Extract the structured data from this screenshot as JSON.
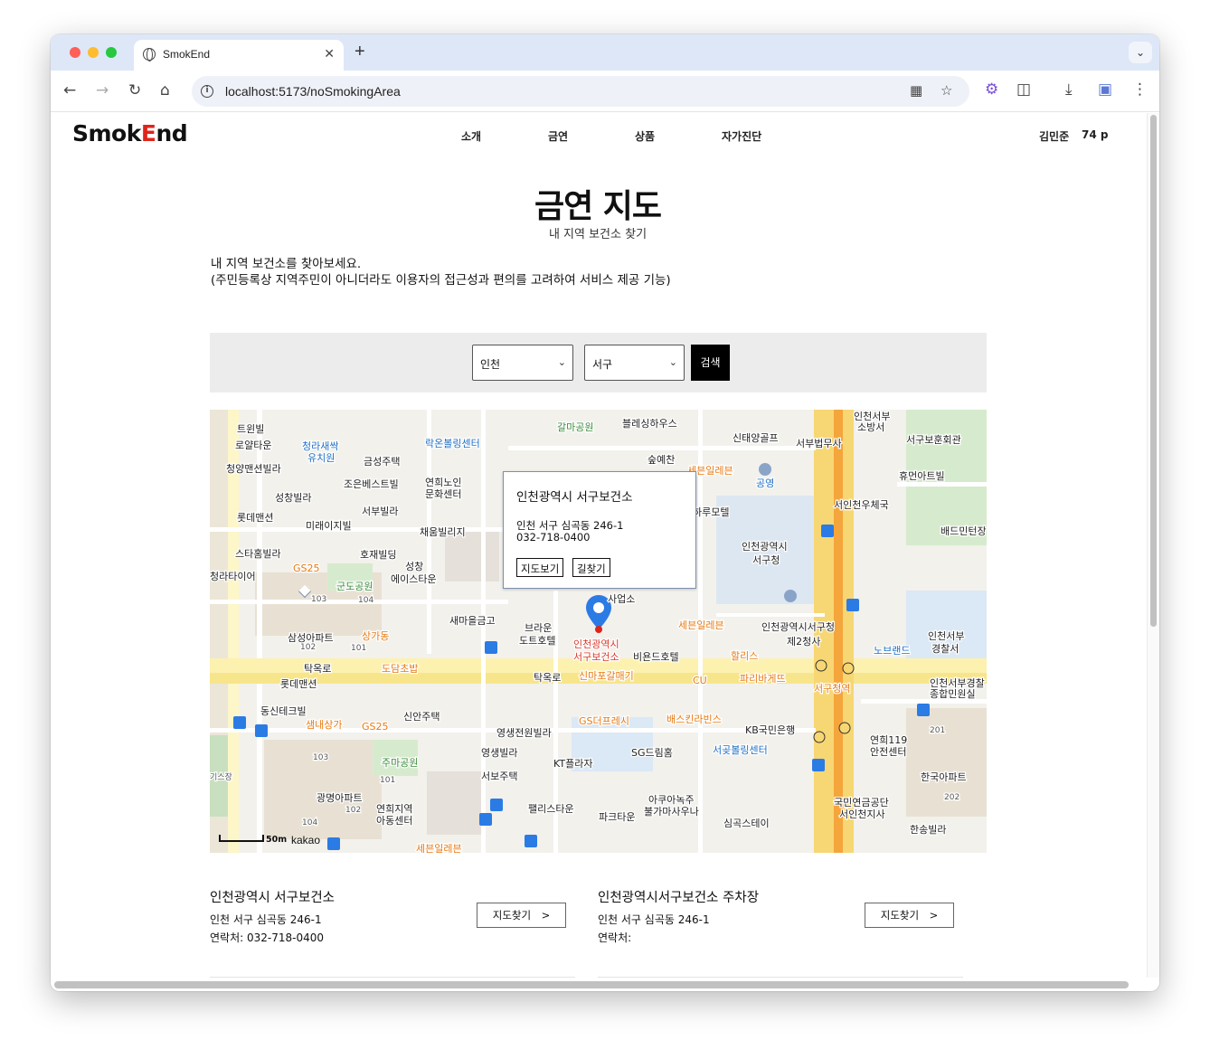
{
  "browser": {
    "tab_title": "SmokEnd",
    "tab_close": "✕",
    "new_tab": "+",
    "tabs_menu": "⌄",
    "url": "localhost:5173/noSmokingArea"
  },
  "site": {
    "logo_part1": "Smok",
    "logo_part2": "E",
    "logo_part3": "nd",
    "nav": [
      "소개",
      "금연",
      "상품",
      "자가진단"
    ],
    "user_name": "김민준",
    "user_points": "74 p"
  },
  "page": {
    "title": "금연 지도",
    "subtitle": "내 지역 보건소 찾기",
    "desc_line1": "내 지역 보건소를 찾아보세요.",
    "desc_line2": "(주민등록상 지역주민이 아니더라도 이용자의 접근성과 편의를 고려하여 서비스 제공 기능)"
  },
  "filters": {
    "city": "인천",
    "district": "서구",
    "search_label": "검색"
  },
  "map": {
    "popup": {
      "title": "인천광역시 서구보건소",
      "address": "인천 서구 심곡동 246-1",
      "phone": "032-718-0400",
      "btn_view": "지도보기",
      "btn_route": "길찾기"
    },
    "scale": "50m",
    "attribution": "kakao",
    "labels": {
      "black": [
        [
          "트윈빌",
          30,
          14
        ],
        [
          "로얄타운",
          28,
          32
        ],
        [
          "청양맨션빌라",
          18,
          58
        ],
        [
          "성창빌라",
          72,
          90
        ],
        [
          "롯데맨션",
          30,
          112
        ],
        [
          "미래이지빌",
          106,
          121
        ],
        [
          "스타홈빌라",
          28,
          152
        ],
        [
          "청라타이어",
          0,
          177
        ],
        [
          "금성주택",
          170,
          50
        ],
        [
          "조은베스트빌",
          148,
          75
        ],
        [
          "서부빌라",
          168,
          105
        ],
        [
          "호재빌딩",
          166,
          153
        ],
        [
          "연희노인",
          238,
          73
        ],
        [
          "문화센터",
          238,
          86
        ],
        [
          "채움빌리지",
          232,
          128
        ],
        [
          "성창",
          216,
          166
        ],
        [
          "에이스타운",
          200,
          180
        ],
        [
          "새마을금고",
          265,
          226
        ],
        [
          "브라운",
          348,
          234
        ],
        [
          "도트호텔",
          342,
          248
        ],
        [
          "블레싱하우스",
          456,
          8
        ],
        [
          "신태양골프",
          578,
          24
        ],
        [
          "숲예찬",
          484,
          48
        ],
        [
          "서부법무사",
          648,
          30
        ],
        [
          "인천서부",
          712,
          0
        ],
        [
          "소방서",
          716,
          12
        ],
        [
          "서구보훈회관",
          770,
          26
        ],
        [
          "휴먼아트빌",
          762,
          66
        ],
        [
          "인천광역시",
          588,
          144
        ],
        [
          "서구청",
          600,
          159
        ],
        [
          "인천광역시서구청",
          610,
          233
        ],
        [
          "제2청사",
          638,
          249
        ],
        [
          "사업소",
          440,
          202
        ],
        [
          "비욘드호텔",
          468,
          266
        ],
        [
          "인천서부",
          794,
          243
        ],
        [
          "경찰서",
          798,
          257
        ],
        [
          "인천서부경찰",
          796,
          295
        ],
        [
          "종합민원실",
          796,
          307
        ],
        [
          "롯데맨션",
          78,
          296
        ],
        [
          "탁옥로",
          104,
          279
        ],
        [
          "탁옥로",
          358,
          289
        ],
        [
          "동신테크빌",
          56,
          326
        ],
        [
          "신안주택",
          214,
          332
        ],
        [
          "영생전원빌라",
          317,
          350
        ],
        [
          "영생빌라",
          300,
          372
        ],
        [
          "서보주택",
          300,
          398
        ],
        [
          "KT플라자",
          380,
          384
        ],
        [
          "SG드림홈",
          466,
          372
        ],
        [
          "KB국민은행",
          592,
          347
        ],
        [
          "연희119",
          730,
          358
        ],
        [
          "안전센터",
          730,
          371
        ],
        [
          "한국아파트",
          786,
          399
        ],
        [
          "국민연금공단",
          690,
          427
        ],
        [
          "서인천지사",
          696,
          440
        ],
        [
          "한송빌라",
          774,
          457
        ],
        [
          "팰리스타운",
          352,
          434
        ],
        [
          "아쿠아녹주",
          485,
          424
        ],
        [
          "불가마사우나",
          480,
          437
        ],
        [
          "파크타운",
          430,
          443
        ],
        [
          "심곡스테이",
          568,
          450
        ],
        [
          "광명아파트",
          118,
          422
        ],
        [
          "연희지역",
          184,
          434
        ],
        [
          "아동센터",
          184,
          447
        ],
        [
          "삼성아파트",
          86,
          245
        ],
        [
          "서인천우체국",
          690,
          98
        ],
        [
          "배드민턴장",
          808,
          127
        ],
        [
          "하루모텔",
          534,
          106
        ]
      ],
      "orange": [
        [
          "GS25",
          92,
          168
        ],
        [
          "상가동",
          168,
          243
        ],
        [
          "도담초밥",
          190,
          279
        ],
        [
          "세븐일레븐",
          528,
          60
        ],
        [
          "세븐일레븐",
          518,
          231
        ],
        [
          "할리스",
          576,
          265
        ],
        [
          "파리바게뜨",
          586,
          290
        ],
        [
          "CU",
          534,
          292
        ],
        [
          "신마포갈매기",
          408,
          287
        ],
        [
          "GS더프레시",
          408,
          337
        ],
        [
          "배스킨라빈스",
          505,
          335
        ],
        [
          "샘내상가",
          106,
          341
        ],
        [
          "GS25",
          168,
          343
        ],
        [
          "세븐일레븐",
          228,
          478
        ],
        [
          "서구청역",
          668,
          301
        ]
      ],
      "green": [
        [
          "군도공원",
          140,
          188
        ],
        [
          "주마공원",
          190,
          383
        ],
        [
          "갈마공원",
          384,
          12
        ]
      ],
      "blue": [
        [
          "청라새싹",
          102,
          33
        ],
        [
          "유치원",
          108,
          46
        ],
        [
          "락온볼링센터",
          238,
          30
        ],
        [
          "공영",
          604,
          74
        ],
        [
          "서곶볼링센터",
          556,
          369
        ],
        [
          "노브랜드",
          734,
          259
        ]
      ],
      "red": [
        [
          "인천광역시",
          402,
          252
        ],
        [
          "서구보건소",
          402,
          266
        ]
      ],
      "small": [
        [
          "103",
          112,
          201
        ],
        [
          "104",
          164,
          202
        ],
        [
          "102",
          100,
          254
        ],
        [
          "101",
          156,
          255
        ],
        [
          "103",
          114,
          376
        ],
        [
          "101",
          188,
          401
        ],
        [
          "102",
          150,
          434
        ],
        [
          "104",
          102,
          448
        ],
        [
          "201",
          796,
          346
        ],
        [
          "202",
          812,
          420
        ],
        [
          "기스장",
          0,
          398
        ]
      ]
    }
  },
  "results": [
    {
      "name": "인천광역시 서구보건소",
      "address": "인천 서구 심곡동 246-1",
      "phone": "연락처: 032-718-0400",
      "btn": "지도찾기　>"
    },
    {
      "name": "인천광역시서구보건소 주차장",
      "address": "인천 서구 심곡동 246-1",
      "phone": "연락처:",
      "btn": "지도찾기　>"
    }
  ],
  "colors": {
    "accent_red": "#e0241b",
    "road_yellow": "#f7d774",
    "road_orange": "#f4a53b",
    "marker_blue": "#2b7be4"
  },
  "icons": [
    "back-arrow-icon",
    "forward-arrow-icon",
    "reload-icon",
    "home-icon",
    "info-icon",
    "translate-icon",
    "star-icon",
    "extension-icon",
    "puzzle-icon",
    "download-icon",
    "profile-icon",
    "kebab-menu-icon",
    "chevron-down-icon",
    "map-marker-icon"
  ]
}
